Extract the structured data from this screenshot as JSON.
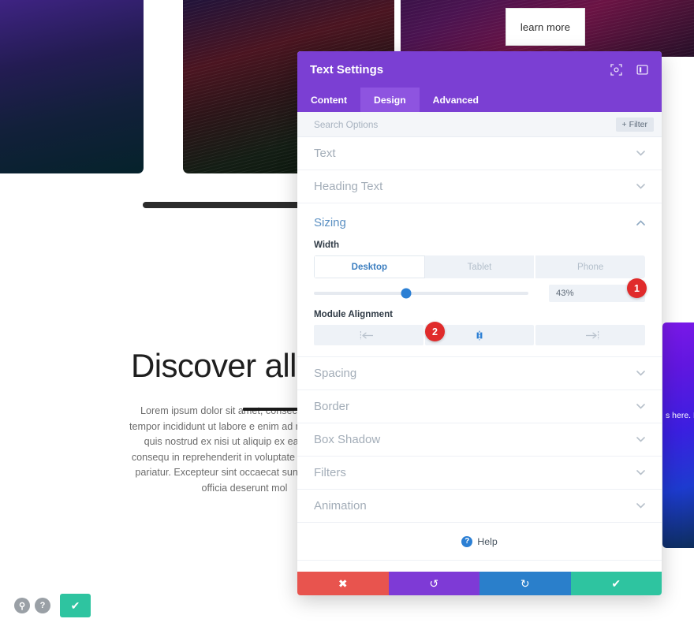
{
  "background": {
    "learn_more_label": "learn more",
    "headline": "Discover all ou",
    "body_copy": "Lorem ipsum dolor sit amet, consectet eiusmod tempor incididunt ut labore e enim ad minim veniam, quis nostrud ex nisi ut aliquip ex ea commodo consequ in reprehenderit in voluptate velit ess nulla pariatur. Excepteur sint occaecat sunt in culpa qui officia deserunt mol",
    "side_card_text": "s here. Edit f this conte",
    "fab": {
      "search_icon": "search-icon",
      "help_icon": "help-icon",
      "confirm_icon": "check-icon",
      "search_glyph": "⚲",
      "help_glyph": "?",
      "confirm_glyph": "✔"
    }
  },
  "modal": {
    "title": "Text Settings",
    "header_icons": [
      {
        "name": "focus-target-icon"
      },
      {
        "name": "panel-layout-icon"
      }
    ],
    "tabs": [
      {
        "label": "Content",
        "active": false
      },
      {
        "label": "Design",
        "active": true
      },
      {
        "label": "Advanced",
        "active": false
      }
    ],
    "search": {
      "placeholder": "Search Options",
      "value": "",
      "filter_label": "Filter",
      "filter_plus": "+"
    },
    "sections": [
      {
        "label": "Text",
        "open": false
      },
      {
        "label": "Heading Text",
        "open": false
      },
      {
        "label": "Sizing",
        "open": true
      },
      {
        "label": "Spacing",
        "open": false
      },
      {
        "label": "Border",
        "open": false
      },
      {
        "label": "Box Shadow",
        "open": false
      },
      {
        "label": "Filters",
        "open": false
      },
      {
        "label": "Animation",
        "open": false
      }
    ],
    "sizing": {
      "width_label": "Width",
      "devices": [
        {
          "label": "Desktop",
          "active": true
        },
        {
          "label": "Tablet",
          "active": false
        },
        {
          "label": "Phone",
          "active": false
        }
      ],
      "slider_percent": 43,
      "value_text": "43%",
      "alignment_label": "Module Alignment",
      "alignment_options": [
        {
          "name": "align-left-icon",
          "active": false
        },
        {
          "name": "align-center-icon",
          "active": true
        },
        {
          "name": "align-right-icon",
          "active": false
        }
      ]
    },
    "help": {
      "label": "Help",
      "glyph": "?"
    },
    "footer": [
      {
        "name": "cancel-button",
        "glyph": "✖",
        "color": "#e8544e"
      },
      {
        "name": "undo-button",
        "glyph": "↺",
        "color": "#7e3ad6"
      },
      {
        "name": "redo-button",
        "glyph": "↻",
        "color": "#2a7fcb"
      },
      {
        "name": "save-button",
        "glyph": "✔",
        "color": "#2ec4a0"
      }
    ]
  },
  "callouts": [
    {
      "number": "1"
    },
    {
      "number": "2"
    }
  ]
}
